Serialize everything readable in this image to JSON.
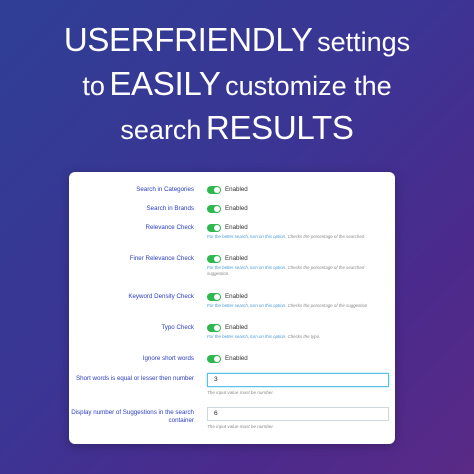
{
  "headline": {
    "line1": "USERFRIENDLY",
    "line1_rest": "settings",
    "line2_pre": "to",
    "line2_big": "EASILY",
    "line2_rest": "customize the",
    "line3_pre": "search",
    "line3_big": "RESULTS"
  },
  "settings": {
    "enabled_text": "Enabled",
    "help_link": "For the better search, turn on this option.",
    "rows": [
      {
        "label": "Search in Categories",
        "state": "Enabled"
      },
      {
        "label": "Search in Brands",
        "state": "Enabled"
      },
      {
        "label": "Relevance Check",
        "state": "Enabled",
        "help_link": "For the better search, turn on this option.",
        "help_text": "Checks the percentage of the searched"
      },
      {
        "label": "Finer Relevance Check",
        "state": "Enabled",
        "help_link": "For the better search, turn on this option.",
        "help_text": "Checks the percentage of the searched suggestion."
      },
      {
        "label": "Keyword Density Check",
        "state": "Enabled",
        "help_link": "For the better search, turn on this option.",
        "help_text": "Checks the percentage of the suggestion"
      },
      {
        "label": "Typo Check",
        "state": "Enabled",
        "help_link": "For the better search, turn on this option.",
        "help_text": "Checks the typo."
      },
      {
        "label": "Ignore short words",
        "state": "Enabled"
      }
    ],
    "short_words": {
      "label": "Short words is equal or lesser then number",
      "value": "3",
      "help": "The input value must be number."
    },
    "suggestions": {
      "label": "Display number of Suggestions in the search container",
      "value": "6",
      "help": "The input value must be number."
    }
  },
  "colors": {
    "toggle_on": "#2eb84f",
    "label": "#2a3dbf",
    "link": "#4a9ad6"
  }
}
